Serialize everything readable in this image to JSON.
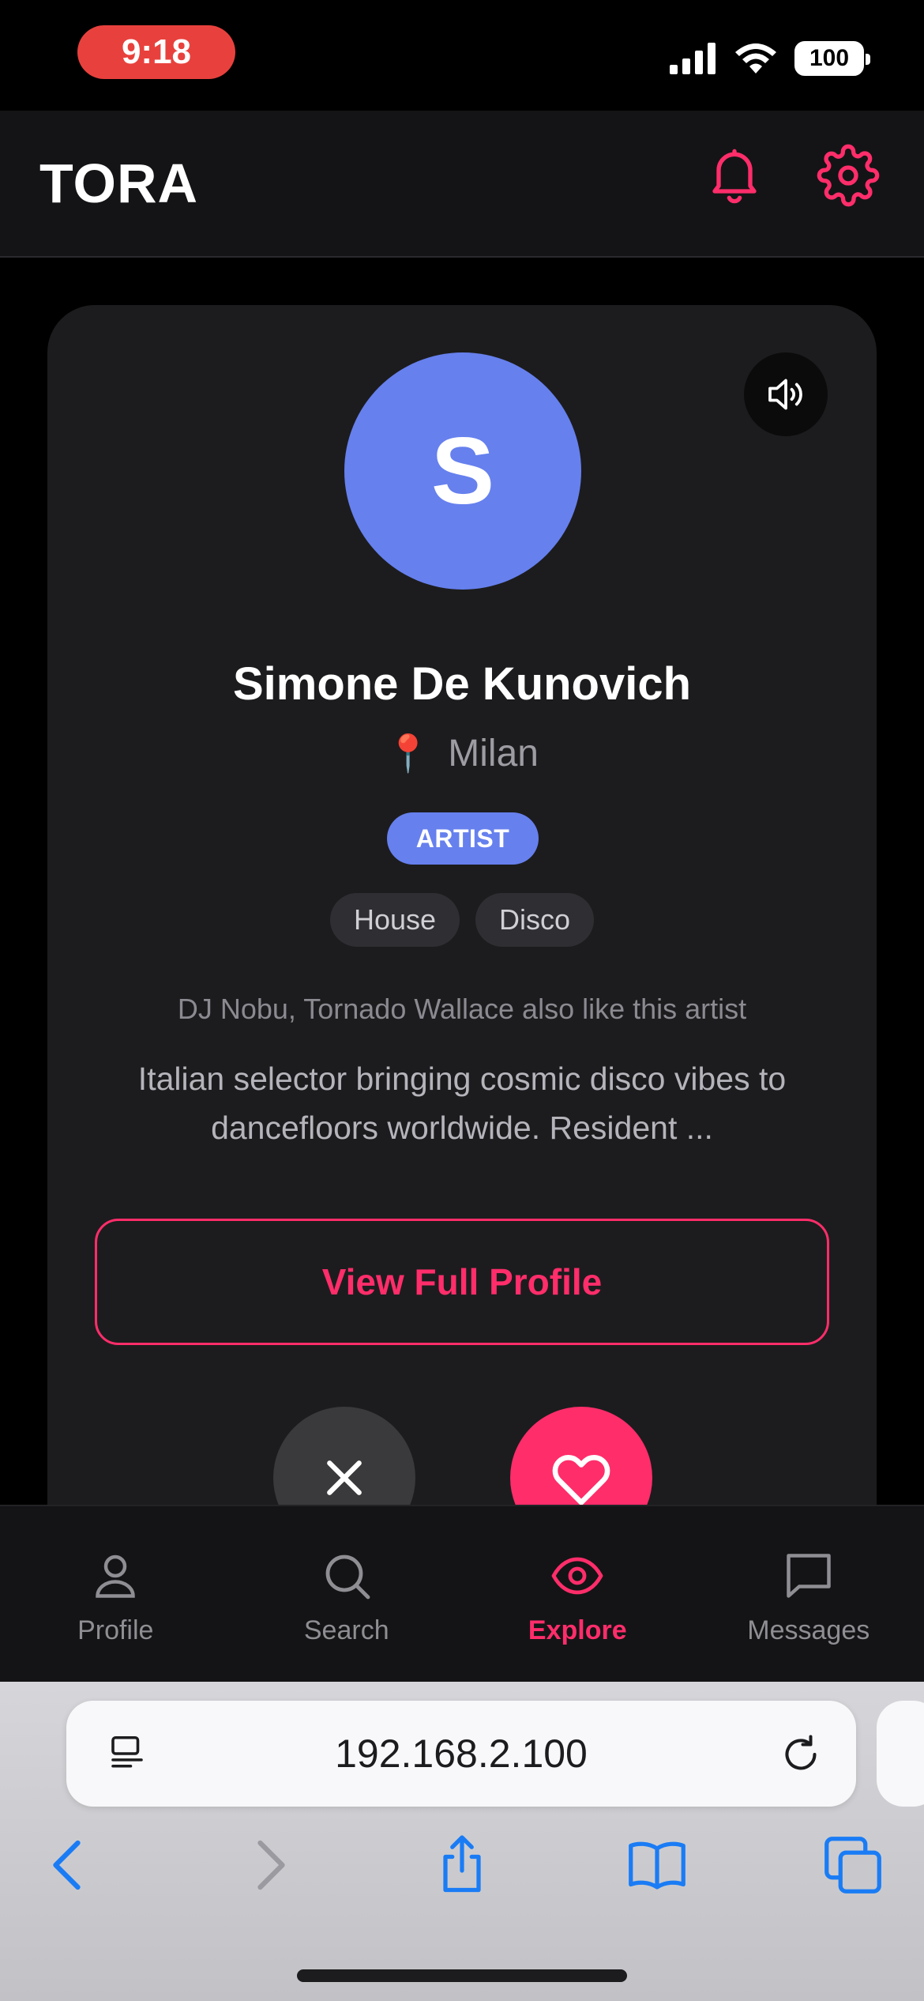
{
  "status_bar": {
    "time": "9:18",
    "battery": "100"
  },
  "header": {
    "title": "TORA"
  },
  "profile": {
    "avatar_initial": "S",
    "name": "Simone De Kunovich",
    "location_icon": "📍",
    "location": "Milan",
    "role": "ARTIST",
    "genres": [
      "House",
      "Disco"
    ],
    "also_like": "DJ Nobu, Tornado Wallace also like this artist",
    "bio": "Italian selector bringing cosmic disco vibes to dancefloors worldwide. Resident ...",
    "view_button": "View Full Profile"
  },
  "nav": {
    "items": [
      {
        "label": "Profile",
        "icon": "person-icon"
      },
      {
        "label": "Search",
        "icon": "search-icon"
      },
      {
        "label": "Explore",
        "icon": "eye-icon"
      },
      {
        "label": "Messages",
        "icon": "chat-icon"
      }
    ],
    "active": "Explore"
  },
  "browser": {
    "url": "192.168.2.100"
  },
  "colors": {
    "accent": "#ff2d6a",
    "avatar": "#6680ee",
    "background": "#000000",
    "card": "#1c1c1e",
    "browser_blue": "#1a7cf5"
  }
}
